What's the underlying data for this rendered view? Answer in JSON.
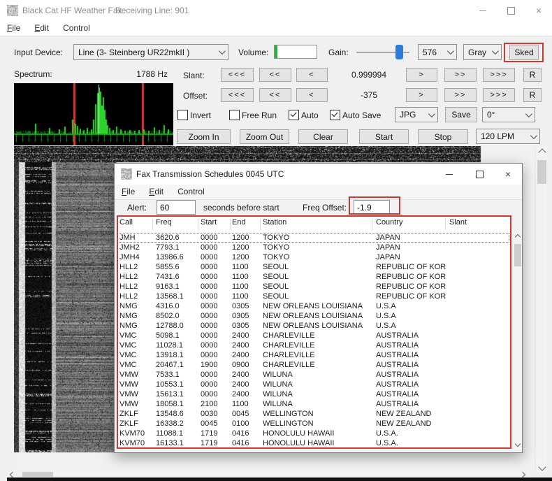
{
  "main_window": {
    "title": "Black Cat HF Weather Fax",
    "receiving_line": "Receiving Line: 901",
    "menu": {
      "file": "File",
      "edit": "Edit",
      "control": "Control"
    },
    "controls": {
      "input_device_label": "Input Device:",
      "input_device_value": "Line (3- Steinberg UR22mkII )",
      "volume_label": "Volume:",
      "gain_label": "Gain:",
      "lines_value": "576",
      "color_value": "Gray",
      "sked_label": "Sked",
      "spectrum_label": "Spectrum:",
      "spectrum_freq": "1788 Hz",
      "slant_label": "Slant:",
      "slant_value": "0.999994",
      "offset_label": "Offset:",
      "offset_value": "-375",
      "step_buttons": {
        "fast_down": "<<<",
        "med_down": "<<",
        "slow_down": "<",
        "slow_up": ">",
        "med_up": ">>",
        "fast_up": ">>>",
        "reset": "R"
      },
      "invert_label": "Invert",
      "free_run_label": "Free Run",
      "auto_label": "Auto",
      "auto_save_label": "Auto Save",
      "format_value": "JPG",
      "save_label": "Save",
      "rotation_value": "0°",
      "zoom_in_label": "Zoom In",
      "zoom_out_label": "Zoom Out",
      "clear_label": "Clear",
      "start_label": "Start",
      "stop_label": "Stop",
      "lpm_value": "120 LPM"
    },
    "icons": {
      "close": "×"
    }
  },
  "schedules_window": {
    "title": "Fax Transmission Schedules 0045 UTC",
    "menu": {
      "file": "File",
      "edit": "Edit",
      "control": "Control"
    },
    "alert_label": "Alert:",
    "alert_value": "60",
    "alert_suffix": "seconds before start",
    "freq_offset_label": "Freq Offset:",
    "freq_offset_value": "-1.9",
    "table": {
      "columns": [
        "Call",
        "Freq",
        "Start",
        "End",
        "Station",
        "Country",
        "Slant"
      ],
      "rows": [
        [
          "JMH",
          "3620.6",
          "0000",
          "1200",
          "TOKYO",
          "JAPAN",
          ""
        ],
        [
          "JMH2",
          "7793.1",
          "0000",
          "1200",
          "TOKYO",
          "JAPAN",
          ""
        ],
        [
          "JMH4",
          "13986.6",
          "0000",
          "1200",
          "TOKYO",
          "JAPAN",
          ""
        ],
        [
          "HLL2",
          "5855.6",
          "0000",
          "1100",
          "SEOUL",
          "REPUBLIC OF KOREA",
          ""
        ],
        [
          "HLL2",
          "7431.6",
          "0000",
          "1100",
          "SEOUL",
          "REPUBLIC OF KOREA",
          ""
        ],
        [
          "HLL2",
          "9163.1",
          "0000",
          "1100",
          "SEOUL",
          "REPUBLIC OF KOREA",
          ""
        ],
        [
          "HLL2",
          "13568.1",
          "0000",
          "1100",
          "SEOUL",
          "REPUBLIC OF KOREA",
          ""
        ],
        [
          "NMG",
          "4316.0",
          "0000",
          "0305",
          "NEW ORLEANS LOUISIANA",
          "U.S.A",
          ""
        ],
        [
          "NMG",
          "8502.0",
          "0000",
          "0305",
          "NEW ORLEANS LOUISIANA",
          "U.S.A",
          ""
        ],
        [
          "NMG",
          "12788.0",
          "0000",
          "0305",
          "NEW ORLEANS LOUISIANA",
          "U.S.A",
          ""
        ],
        [
          "VMC",
          "5098.1",
          "0000",
          "2400",
          "CHARLEVILLE",
          "AUSTRALIA",
          ""
        ],
        [
          "VMC",
          "11028.1",
          "0000",
          "2400",
          "CHARLEVILLE",
          "AUSTRALIA",
          ""
        ],
        [
          "VMC",
          "13918.1",
          "0000",
          "2400",
          "CHARLEVILLE",
          "AUSTRALIA",
          ""
        ],
        [
          "VMC",
          "20467.1",
          "1900",
          "0900",
          "CHARLEVILLE",
          "AUSTRALIA",
          ""
        ],
        [
          "VMW",
          "7533.1",
          "0000",
          "2400",
          "WILUNA",
          "AUSTRALIA",
          ""
        ],
        [
          "VMW",
          "10553.1",
          "0000",
          "2400",
          "WILUNA",
          "AUSTRALIA",
          ""
        ],
        [
          "VMW",
          "15613.1",
          "0000",
          "2400",
          "WILUNA",
          "AUSTRALIA",
          ""
        ],
        [
          "VMW",
          "18058.1",
          "2100",
          "1100",
          "WILUNA",
          "AUSTRALIA",
          ""
        ],
        [
          "ZKLF",
          "13548.6",
          "0030",
          "0045",
          "WELLINGTON",
          "NEW ZEALAND",
          ""
        ],
        [
          "ZKLF",
          "16338.2",
          "0045",
          "0100",
          "WELLINGTON",
          "NEW ZEALAND",
          ""
        ],
        [
          "KVM70",
          "11088.1",
          "1719",
          "0416",
          "HONOLULU HAWAII",
          "U.S.A.",
          ""
        ],
        [
          "KVM70",
          "16133.1",
          "1719",
          "0416",
          "HONOLULU HAWAII",
          "U.S.A.",
          ""
        ]
      ]
    }
  },
  "colors": {
    "annotation_red": "#cc3a34",
    "spectrum_green": "#2bd42b",
    "spectrum_marker_red": "#e03432",
    "slider_thumb_blue": "#2f7cd6",
    "volume_green": "#28b43c"
  }
}
